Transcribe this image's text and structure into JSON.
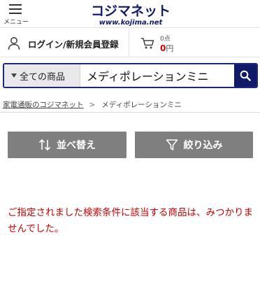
{
  "header": {
    "menu_label": "メニュー",
    "logo_main": "コジマネット",
    "logo_sub": "www.kojima.net"
  },
  "account": {
    "login_label": "ログイン/新規会員登録",
    "cart_count": "0点",
    "cart_total_number": "0",
    "cart_total_unit": "円"
  },
  "search": {
    "category": "全ての商品",
    "query": "メディポレーションミニ"
  },
  "breadcrumb": {
    "home": "家電通販のコジマネット",
    "separator": ">",
    "current": "メディポレーションミニ"
  },
  "actions": {
    "sort_label": "並べ替え",
    "filter_label": "絞り込み"
  },
  "message": {
    "no_results": "ご指定されました検索条件に該当する商品は、みつかりませんでした。"
  },
  "colors": {
    "brand_navy": "#11196a",
    "error_red": "#c40000",
    "price_red": "#d00000",
    "button_gray": "#7f7f7f"
  }
}
